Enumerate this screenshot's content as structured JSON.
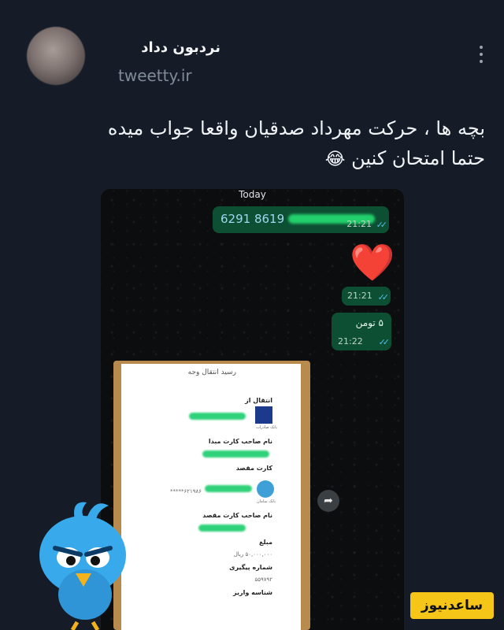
{
  "tweet": {
    "author_name": "نردبون دداد",
    "handle": "tweetty.ir",
    "text_line1": "بچه ها ، حرکت مهرداد صدقیان واقعا جواب میده",
    "text_line2": "حتما امتحان کنین",
    "emoji": "😂",
    "menu_icon": "more-vertical-icon"
  },
  "chat": {
    "day_label": "Today",
    "messages": [
      {
        "text": "6291 8619",
        "time": "21:21"
      },
      {
        "emoji": "❤️",
        "time": "21:21"
      },
      {
        "text": "۵ تومن",
        "time": "21:22"
      }
    ],
    "forward_icon": "forward-arrow-icon"
  },
  "receipt": {
    "title": "رسید انتقال وجه",
    "from_label": "انتقال از",
    "bank1_label": "بانک صادرات",
    "source_owner_label": "نام صاحب کارت مبدا",
    "dest_card_label": "کارت مقصد",
    "dest_card_number": "۶۲۱۹۸۶*****",
    "bank2_label": "بانک سامان",
    "dest_owner_label": "نام صاحب کارت مقصد",
    "amount_label": "مبلغ",
    "amount_value": "۵۰,۰۰۰,۰۰۰ ریال",
    "tracking_label": "شماره پیگیری",
    "tracking_value": "۵۵۹۷۹۲",
    "deposit_label": "شناسه واریز"
  },
  "branding": {
    "logo_text": "ساعدنیوز",
    "logo_bg": "#f5c517"
  }
}
